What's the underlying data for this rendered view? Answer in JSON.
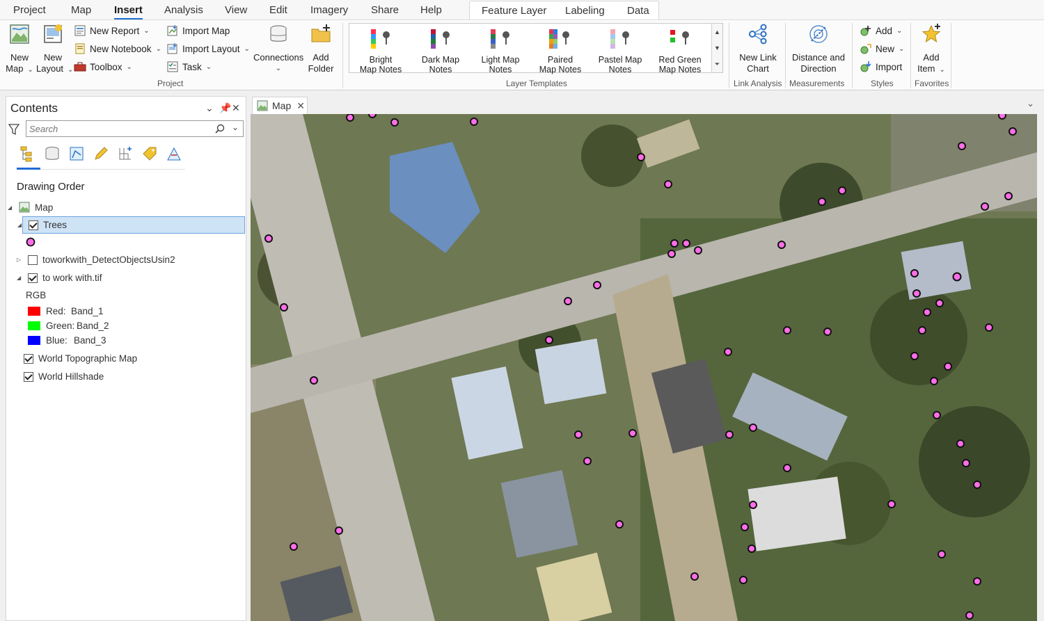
{
  "ribbon": {
    "tabs": [
      "Project",
      "Map",
      "Insert",
      "Analysis",
      "View",
      "Edit",
      "Imagery",
      "Share",
      "Help"
    ],
    "active_tab": "Insert",
    "context_tabs": [
      "Feature Layer",
      "Labeling",
      "Data"
    ],
    "project_group": {
      "label": "Project",
      "new_map": [
        "New",
        "Map"
      ],
      "new_layout": [
        "New",
        "Layout"
      ],
      "new_report": "New Report",
      "new_notebook": "New Notebook",
      "toolbox": "Toolbox",
      "import_map": "Import Map",
      "import_layout": "Import Layout",
      "task": "Task",
      "connections": "Connections",
      "add_folder": [
        "Add",
        "Folder"
      ]
    },
    "layer_templates": {
      "label": "Layer Templates",
      "items": [
        {
          "line1": "Bright",
          "line2": "Map Notes"
        },
        {
          "line1": "Dark Map",
          "line2": "Notes"
        },
        {
          "line1": "Light Map",
          "line2": "Notes"
        },
        {
          "line1": "Paired",
          "line2": "Map Notes"
        },
        {
          "line1": "Pastel Map",
          "line2": "Notes"
        },
        {
          "line1": "Red Green",
          "line2": "Map Notes"
        }
      ]
    },
    "link_analysis": {
      "label": "Link Analysis",
      "new_link_chart": [
        "New Link",
        "Chart"
      ]
    },
    "measurements": {
      "label": "Measurements",
      "distance_direction": [
        "Distance and",
        "Direction"
      ]
    },
    "styles": {
      "label": "Styles",
      "add": "Add",
      "new": "New",
      "import": "Import"
    },
    "favorites": {
      "label": "Favorites",
      "add_item": [
        "Add",
        "Item"
      ]
    }
  },
  "contents": {
    "title": "Contents",
    "search_placeholder": "Search",
    "drawing_order_title": "Drawing Order",
    "map_name": "Map",
    "layers": {
      "trees": "Trees",
      "detect": "toworkwith_DetectObjectsUsin2",
      "raster": "to work with.tif",
      "rgb_label": "RGB",
      "bands": [
        {
          "label": "Red:",
          "value": "Band_1",
          "color": "#ff0000"
        },
        {
          "label": "Green:",
          "value": "Band_2",
          "color": "#00ff00"
        },
        {
          "label": "Blue:",
          "value": "Band_3",
          "color": "#0000ff"
        }
      ],
      "topo": "World Topographic Map",
      "hillshade": "World Hillshade"
    }
  },
  "map_view": {
    "tab_label": "Map"
  },
  "colors": {
    "accent": "#1f6bd6",
    "tree_point": "#ff6ee8",
    "selection": "#cfe3f7"
  }
}
